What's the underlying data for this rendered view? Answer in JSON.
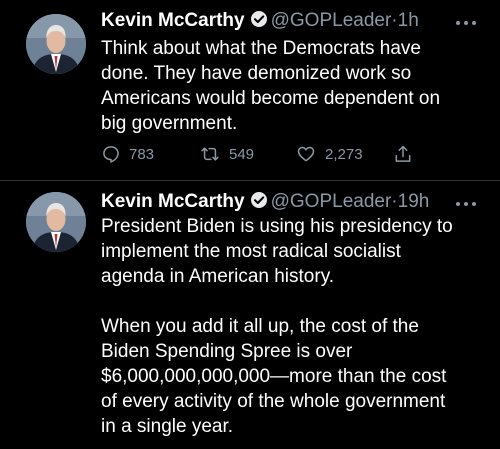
{
  "tweets": [
    {
      "name": "Kevin McCarthy",
      "handle": "@GOPLeader",
      "separator": "·",
      "time": "1h",
      "text": "Think about what the Democrats have\ndone. They have demonized work so\nAmericans would become dependent on\nbig government.",
      "replies": "783",
      "retweets": "549",
      "likes": "2,273"
    },
    {
      "name": "Kevin McCarthy",
      "handle": "@GOPLeader",
      "separator": "·",
      "time": "19h",
      "text": "President Biden is using his presidency to\nimplement the most radical socialist\nagenda in American history.\n\nWhen you add it all up, the cost of the\nBiden Spending Spree is over\n$6,000,000,000,000—more than the cost\nof every activity of the whole government\nin a single year."
    }
  ],
  "icons": {
    "verified": "verified-badge-icon",
    "more": "more-horizontal-icon",
    "reply": "reply-icon",
    "retweet": "retweet-icon",
    "like": "heart-icon",
    "share": "share-icon"
  },
  "colors": {
    "background": "#000000",
    "text": "#ffffff",
    "secondary": "#8b98a5",
    "divider": "#2f3336"
  }
}
